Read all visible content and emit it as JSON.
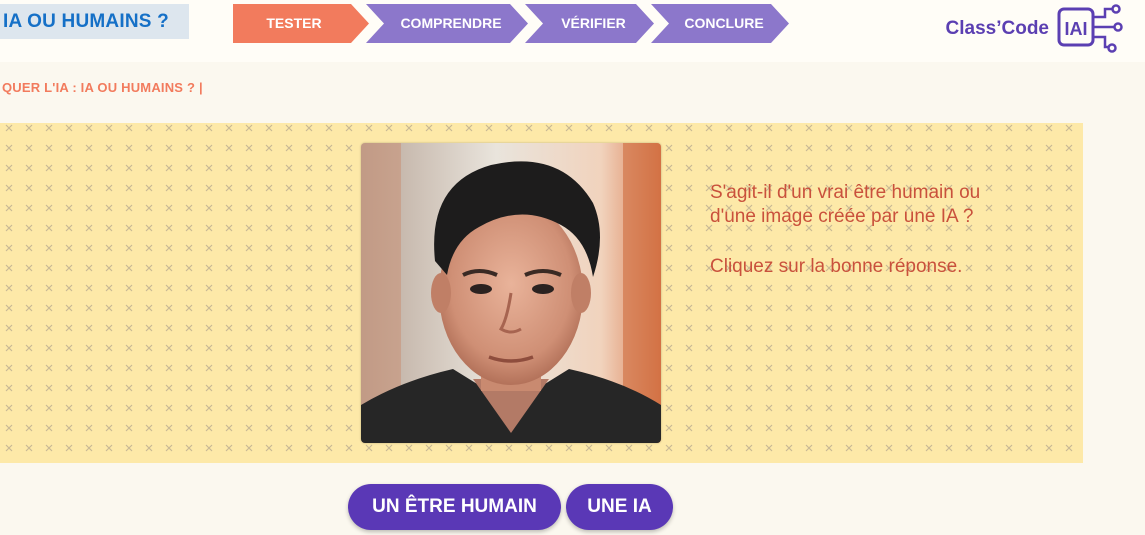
{
  "header": {
    "app_title": "IA OU HUMAINS ?",
    "steps": [
      {
        "label": "TESTER",
        "color": "#f27b5d",
        "active": true
      },
      {
        "label": "COMPRENDRE",
        "color": "#8c77cb",
        "active": false
      },
      {
        "label": "VÉRIFIER",
        "color": "#8c77cb",
        "active": false
      },
      {
        "label": "CONCLURE",
        "color": "#8c77cb",
        "active": false
      }
    ],
    "brand": {
      "name": "Class’Code",
      "badge": "IAI",
      "color": "#5b3fb2"
    }
  },
  "breadcrumb": "QUER L'IA : IA OU HUMAINS ? |",
  "main": {
    "image_icon": "portrait-photo",
    "question": "S'agit-il d'un vrai être humain ou d'une image créée par une IA ?",
    "instruction": "Cliquez sur la bonne réponse."
  },
  "answers": {
    "human_label": "UN ÊTRE HUMAIN",
    "ai_label": "UNE IA"
  },
  "colors": {
    "accent_orange": "#f27b5d",
    "accent_purple": "#8c77cb",
    "button_purple": "#5a38b6",
    "prompt_red": "#c9513c",
    "stage_yellow": "#fde9a8"
  }
}
